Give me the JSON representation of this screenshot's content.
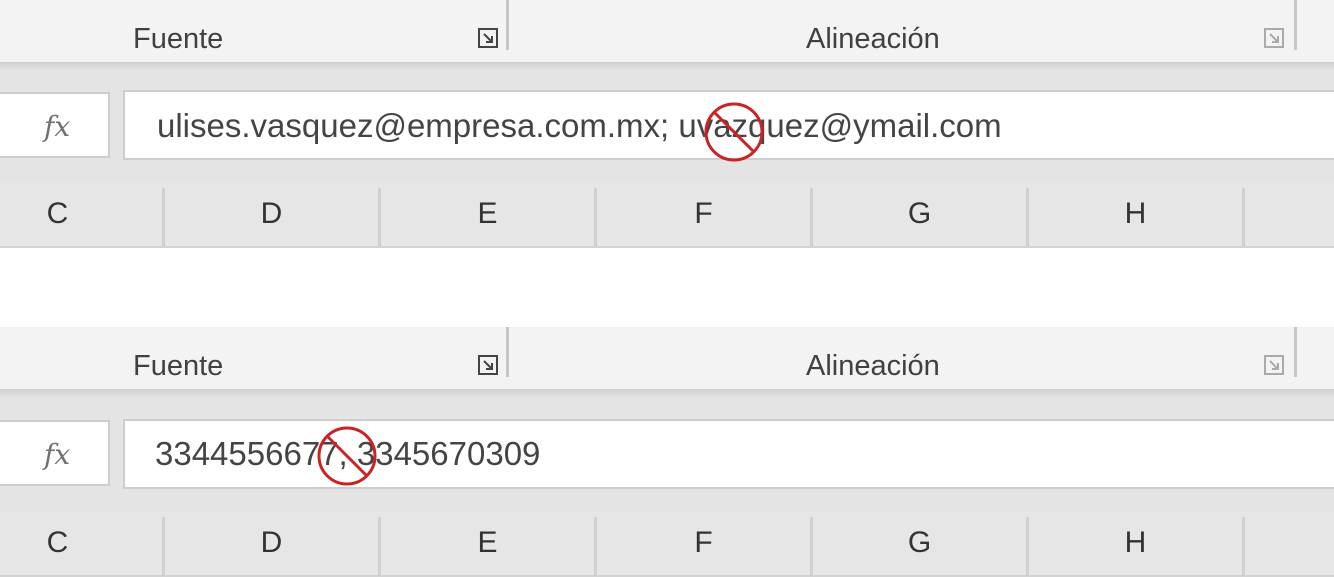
{
  "panels": [
    {
      "ribbon": {
        "group_fuente": "Fuente",
        "group_alineacion": "Alineación"
      },
      "formula_bar": {
        "fx_label": "fx",
        "value": "ulises.vasquez@empresa.com.mx; uvazquez@ymail.com"
      },
      "columns": [
        "C",
        "D",
        "E",
        "F",
        "G",
        "H"
      ],
      "annotation": {
        "icon": "prohibited-circle-icon",
        "color": "#cc2222"
      }
    },
    {
      "ribbon": {
        "group_fuente": "Fuente",
        "group_alineacion": "Alineación"
      },
      "formula_bar": {
        "fx_label": "fx",
        "value": "3344556677, 3345670309"
      },
      "columns": [
        "C",
        "D",
        "E",
        "F",
        "G",
        "H"
      ],
      "annotation": {
        "icon": "prohibited-circle-icon",
        "color": "#cc2222"
      }
    }
  ]
}
